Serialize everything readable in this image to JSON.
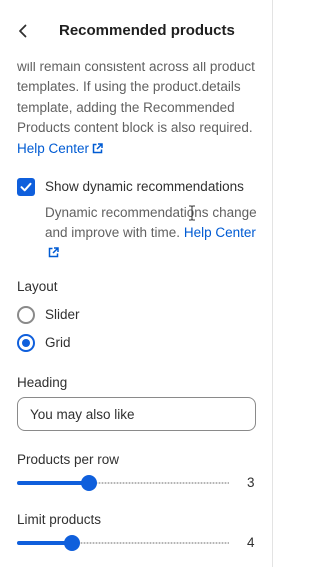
{
  "header": {
    "title": "Recommended products"
  },
  "intro": {
    "text": "will remain consistent across all product templates. If using the product.details template, adding the Recommended Products content block is also required.",
    "link_label": "Help Center"
  },
  "dynamic": {
    "checkbox_label": "Show dynamic recommendations",
    "checked": true,
    "help_text": "Dynamic recommendations change and improve with time.",
    "link_label": "Help Center"
  },
  "layout": {
    "label": "Layout",
    "options": [
      {
        "label": "Slider",
        "selected": false
      },
      {
        "label": "Grid",
        "selected": true
      }
    ]
  },
  "heading": {
    "label": "Heading",
    "value": "You may also like"
  },
  "products_per_row": {
    "label": "Products per row",
    "value": "3",
    "fraction": 0.34
  },
  "limit_products": {
    "label": "Limit products",
    "value": "4",
    "fraction": 0.26
  },
  "colors": {
    "accent": "#0f5fdc",
    "link": "#005bd3"
  }
}
